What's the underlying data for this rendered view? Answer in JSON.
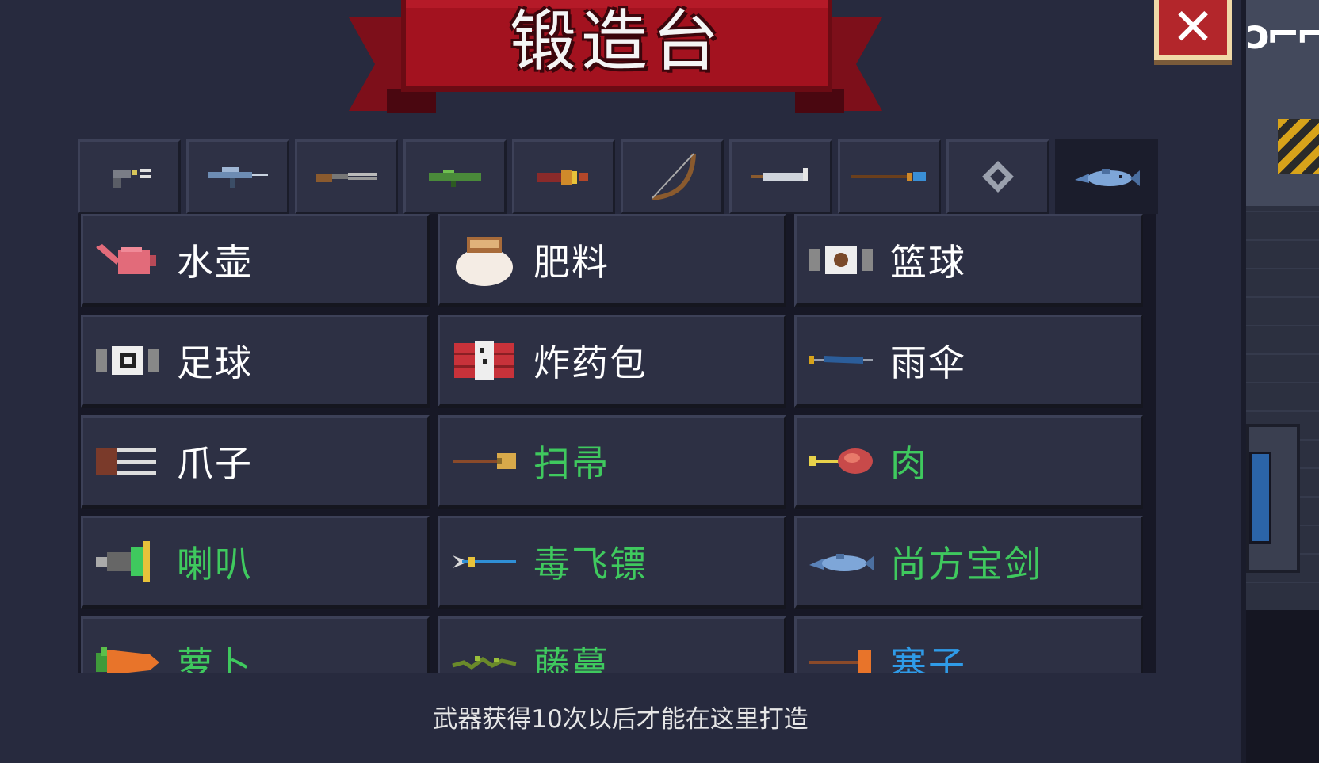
{
  "window": {
    "title": "锻造台",
    "close_icon": "close-x-icon"
  },
  "tabs": [
    {
      "icon": "pistol-icon",
      "active": false
    },
    {
      "icon": "rifle-icon",
      "active": false
    },
    {
      "icon": "shotgun-icon",
      "active": false
    },
    {
      "icon": "launcher-icon",
      "active": false
    },
    {
      "icon": "special-gun-icon",
      "active": false
    },
    {
      "icon": "bow-icon",
      "active": false
    },
    {
      "icon": "sword-icon",
      "active": false
    },
    {
      "icon": "staff-icon",
      "active": false
    },
    {
      "icon": "throwable-icon",
      "active": false
    },
    {
      "icon": "fish-weapon-icon",
      "active": true
    }
  ],
  "items": [
    {
      "name": "水壶",
      "icon": "watering-can-icon",
      "color": "#ffffff"
    },
    {
      "name": "肥料",
      "icon": "fertilizer-bag-icon",
      "color": "#ffffff"
    },
    {
      "name": "篮球",
      "icon": "basketball-icon",
      "color": "#ffffff"
    },
    {
      "name": "足球",
      "icon": "football-icon",
      "color": "#ffffff"
    },
    {
      "name": "炸药包",
      "icon": "dynamite-pack-icon",
      "color": "#ffffff"
    },
    {
      "name": "雨伞",
      "icon": "umbrella-icon",
      "color": "#ffffff"
    },
    {
      "name": "爪子",
      "icon": "claw-icon",
      "color": "#ffffff"
    },
    {
      "name": "扫帚",
      "icon": "broom-icon",
      "color": "#3fc95e"
    },
    {
      "name": "肉",
      "icon": "meat-icon",
      "color": "#3fc95e"
    },
    {
      "name": "喇叭",
      "icon": "horn-icon",
      "color": "#3fc95e"
    },
    {
      "name": "毒飞镖",
      "icon": "poison-dart-icon",
      "color": "#3fc95e"
    },
    {
      "name": "尚方宝剑",
      "icon": "fish-sword-icon",
      "color": "#3fc95e"
    },
    {
      "name": "萝卜",
      "icon": "carrot-icon",
      "color": "#3fc95e"
    },
    {
      "name": "藤蔓",
      "icon": "vine-icon",
      "color": "#3fc95e"
    },
    {
      "name": "塞子",
      "icon": "plunger-icon",
      "color": "#2f9be8"
    }
  ],
  "footer": {
    "hint": "武器获得10次以后才能在这里打造"
  }
}
